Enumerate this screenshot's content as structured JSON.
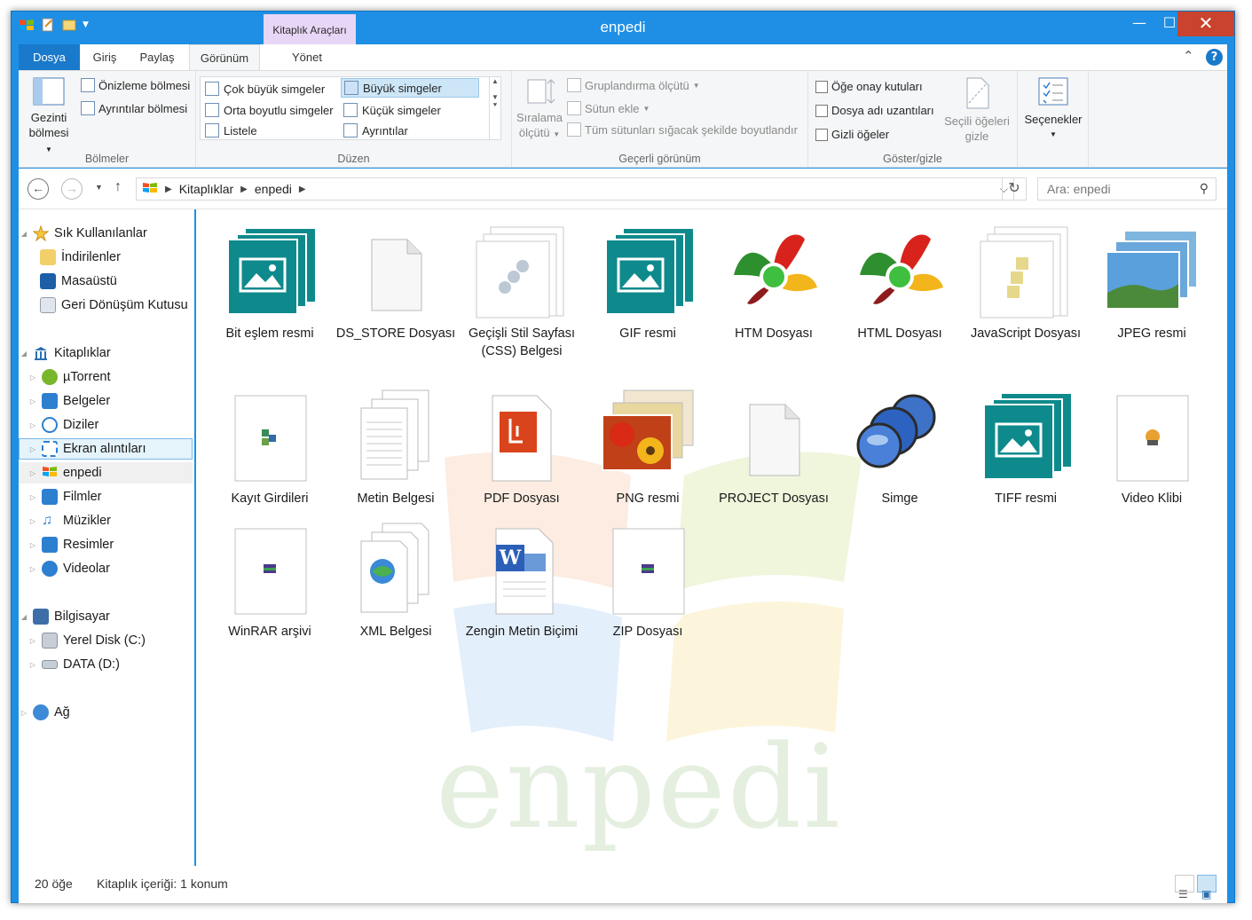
{
  "window": {
    "title": "enpedi",
    "context_tab": "Kitaplık Araçları",
    "minimize": "—",
    "maximize": "☐",
    "close": "✕"
  },
  "ribbon_tabs": {
    "file": "Dosya",
    "home": "Giriş",
    "share": "Paylaş",
    "view": "Görünüm",
    "manage": "Yönet"
  },
  "ribbon": {
    "panes": {
      "nav_pane_label": "Gezinti",
      "nav_pane_label2": "bölmesi",
      "preview_pane": "Önizleme bölmesi",
      "details_pane": "Ayrıntılar bölmesi",
      "group_label": "Bölmeler"
    },
    "layout": {
      "items": [
        "Çok büyük simgeler",
        "Büyük simgeler",
        "Orta boyutlu simgeler",
        "Küçük simgeler",
        "Listele",
        "Ayrıntılar"
      ],
      "active": "Büyük simgeler",
      "group_label": "Düzen"
    },
    "current_view": {
      "sort_label": "Sıralama",
      "sort_label2": "ölçütü",
      "group_by": "Gruplandırma ölçütü",
      "add_columns": "Sütun ekle",
      "size_columns": "Tüm sütunları sığacak şekilde boyutlandır",
      "group_label": "Geçerli görünüm"
    },
    "show_hide": {
      "item_checkboxes": "Öğe onay kutuları",
      "file_extensions": "Dosya adı uzantıları",
      "hidden_items": "Gizli öğeler",
      "hide_selected": "Seçili öğeleri",
      "hide_selected2": "gizle",
      "group_label": "Göster/gizle"
    },
    "options": "Seçenekler"
  },
  "address": {
    "segments": [
      "Kitaplıklar",
      "enpedi"
    ],
    "search_placeholder": "Ara: enpedi"
  },
  "nav_pane": {
    "favorites": {
      "label": "Sık Kullanılanlar",
      "items": [
        "İndirilenler",
        "Masaüstü",
        "Geri Dönüşüm Kutusu"
      ]
    },
    "libraries": {
      "label": "Kitaplıklar",
      "items": [
        "µTorrent",
        "Belgeler",
        "Diziler",
        "Ekran alıntıları",
        "enpedi",
        "Filmler",
        "Müzikler",
        "Resimler",
        "Videolar"
      ],
      "selected": "Ekran alıntıları",
      "current": "enpedi"
    },
    "computer": {
      "label": "Bilgisayar",
      "items": [
        "Yerel Disk (C:)",
        "DATA (D:)"
      ]
    },
    "network": {
      "label": "Ağ"
    }
  },
  "files": [
    {
      "name": "Bit eşlem resmi",
      "icon": "image-tile-stack-icon"
    },
    {
      "name": "DS_STORE Dosyası",
      "icon": "blank-file-icon"
    },
    {
      "name": "Geçişli Stil Sayfası (CSS) Belgesi",
      "icon": "css-stack-icon"
    },
    {
      "name": "GIF resmi",
      "icon": "image-tile-stack-icon"
    },
    {
      "name": "HTM Dosyası",
      "icon": "browser-flower-icon"
    },
    {
      "name": "HTML Dosyası",
      "icon": "browser-flower-icon"
    },
    {
      "name": "JavaScript Dosyası",
      "icon": "script-stack-icon"
    },
    {
      "name": "JPEG resmi",
      "icon": "landscape-stack-icon"
    },
    {
      "name": "Kayıt Girdileri",
      "icon": "registry-file-icon"
    },
    {
      "name": "Metin Belgesi",
      "icon": "text-doc-stack-icon"
    },
    {
      "name": "PDF Dosyası",
      "icon": "pdf-file-icon"
    },
    {
      "name": "PNG resmi",
      "icon": "flower-photo-stack-icon"
    },
    {
      "name": "PROJECT Dosyası",
      "icon": "blank-file-icon"
    },
    {
      "name": "Simge",
      "icon": "orb-cluster-icon"
    },
    {
      "name": "TIFF resmi",
      "icon": "image-tile-stack-icon"
    },
    {
      "name": "Video Klibi",
      "icon": "video-file-icon"
    },
    {
      "name": "WinRAR arşivi",
      "icon": "archive-file-icon"
    },
    {
      "name": "XML Belgesi",
      "icon": "xml-doc-stack-icon"
    },
    {
      "name": "Zengin Metin Biçimi",
      "icon": "word-doc-icon"
    },
    {
      "name": "ZIP Dosyası",
      "icon": "archive-file-icon"
    }
  ],
  "watermark": "enpedi",
  "status": {
    "count": "20 öğe",
    "library_info": "Kitaplık içeriği: 1 konum"
  },
  "colors": {
    "titlebar": "#1e8fe4",
    "file_tab": "#1979ca",
    "context_tab": "#e8d6f6",
    "close_button": "#c9432e",
    "selection": "#e5f3fb",
    "teal_tile": "#0e8a8c"
  }
}
